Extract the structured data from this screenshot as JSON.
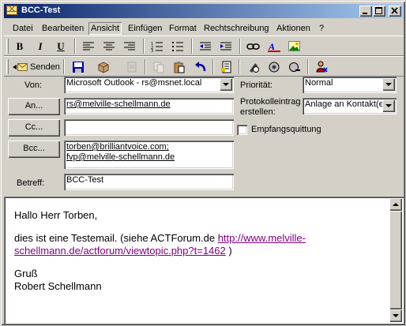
{
  "window": {
    "title": "BCC-Test"
  },
  "menu": {
    "items": [
      {
        "label": "Datei"
      },
      {
        "label": "Bearbeiten"
      },
      {
        "label": "Ansicht"
      },
      {
        "label": "Einfügen"
      },
      {
        "label": "Format"
      },
      {
        "label": "Rechtschreibung"
      },
      {
        "label": "Aktionen"
      },
      {
        "label": "?"
      }
    ]
  },
  "format_toolbar": {
    "bold": "B",
    "italic": "I",
    "underline": "U"
  },
  "standard_toolbar": {
    "send_label": "Senden"
  },
  "form": {
    "from_label": "Von:",
    "from_value": "Microsoft Outlook - rs@msnet.local",
    "to_button": "An...",
    "to_value": "rs@melville-schellmann.de",
    "cc_button": "Cc...",
    "cc_value": "",
    "bcc_button": "Bcc...",
    "bcc_values": [
      "torben@brilliantvoice.com;",
      "fvp@melville-schellmann.de"
    ],
    "subject_label": "Betreff:",
    "subject_value": "BCC-Test",
    "priority_label": "Priorität:",
    "priority_value": "Normal",
    "protocol_label_1": "Protokolleintrag",
    "protocol_label_2": "erstellen:",
    "protocol_value": "Anlage an Kontakt(e)",
    "receipt_label": "Empfangsquittung",
    "receipt_checked": false
  },
  "message": {
    "greeting": "Hallo Herr Torben,",
    "line1_before": "dies ist eine Testemail. (siehe ACTForum.de ",
    "link_part1": "http://www.melville-",
    "link_part2": "schellmann.de/actforum/viewtopic.php?t=1462",
    "line1_after": " )",
    "closing": "Gruß",
    "signature": "Robert Schellmann"
  },
  "colors": {
    "titlebar_start": "#0a246a",
    "titlebar_end": "#a6caf0",
    "link_visited": "#800080",
    "face": "#d4d0c8"
  }
}
